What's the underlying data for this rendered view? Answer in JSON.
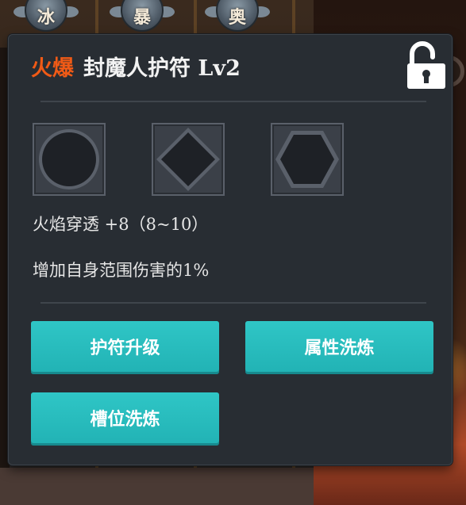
{
  "background": {
    "top_icons": [
      {
        "glyph": "冰",
        "icon": "ice-rune-icon"
      },
      {
        "glyph": "暴",
        "icon": "crit-rune-icon"
      },
      {
        "glyph": "奥",
        "icon": "arcane-rune-icon"
      }
    ]
  },
  "amulet": {
    "element": "火爆",
    "name": "封魔人护符 Lv2",
    "lock_state": "unlocked",
    "lock_icon": "unlocked-padlock-icon",
    "slots": [
      {
        "shape": "circle",
        "icon": "circle-socket-icon"
      },
      {
        "shape": "diamond",
        "icon": "diamond-socket-icon"
      },
      {
        "shape": "hexagon",
        "icon": "hexagon-socket-icon"
      }
    ],
    "stats": [
      "火焰穿透 +8（8~10）",
      "增加自身范围伤害的1%"
    ]
  },
  "actions": {
    "upgrade_label": "护符升级",
    "reroll_attributes_label": "属性洗炼",
    "reroll_slots_label": "槽位洗炼"
  },
  "colors": {
    "element_text": "#f05a16",
    "button": "#22b3b5",
    "panel": "#282d33"
  }
}
